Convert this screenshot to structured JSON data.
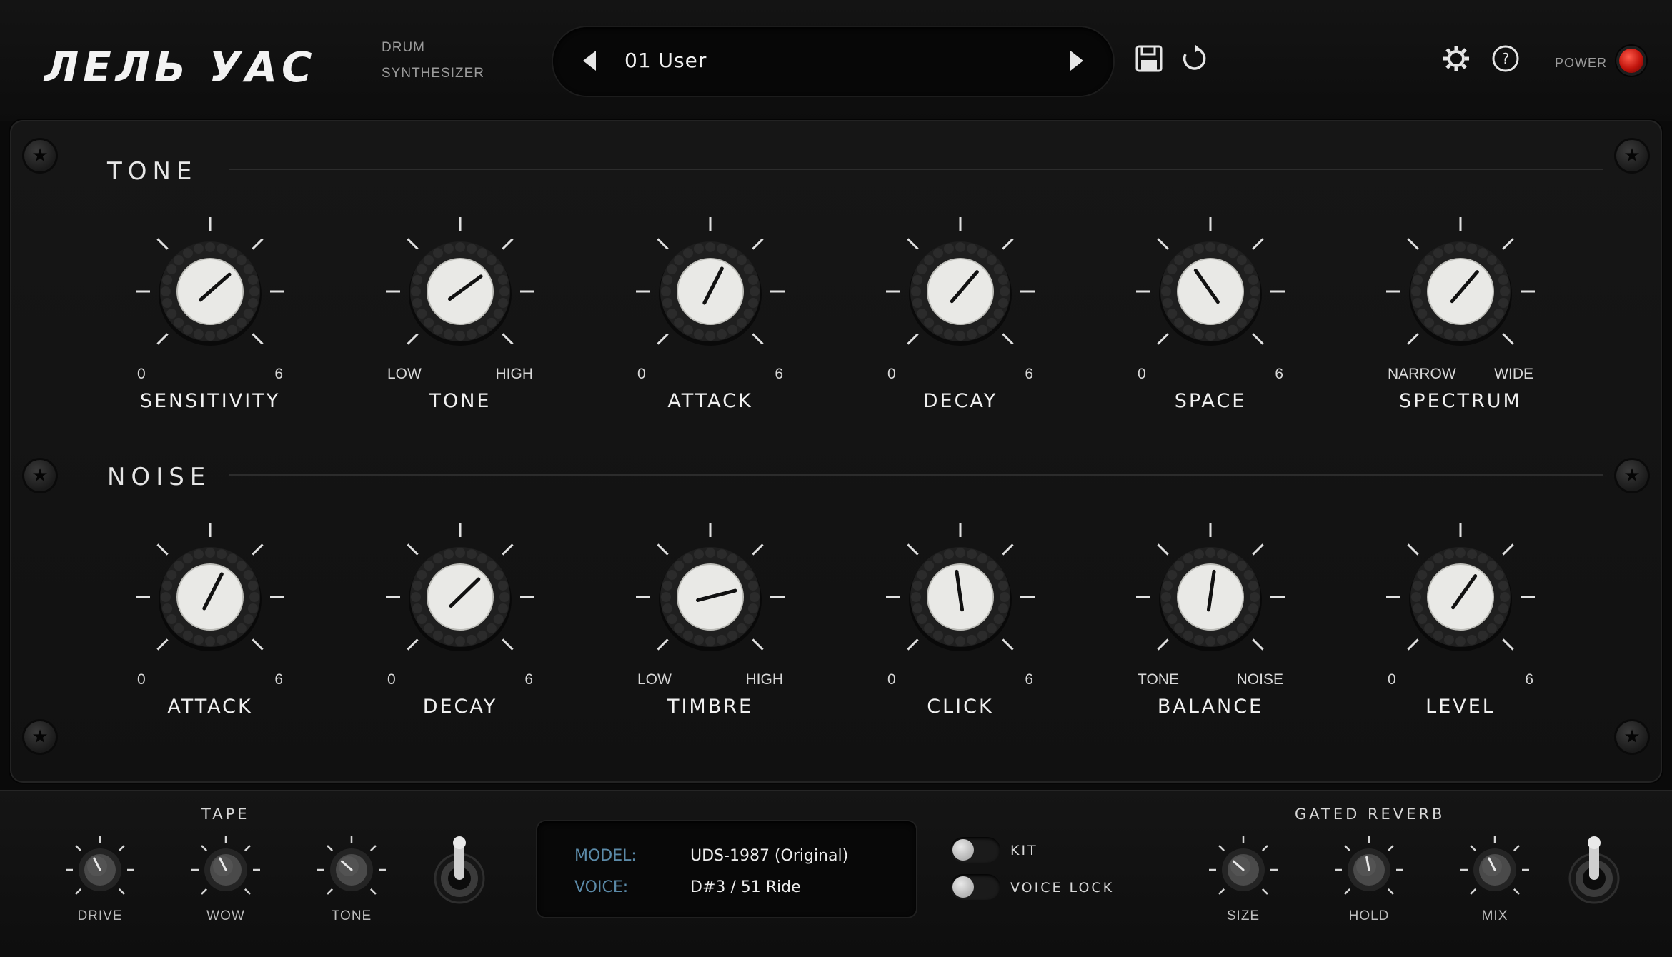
{
  "header": {
    "logo_text": "ЛЕЛЬ УАС",
    "logo_sub_1": "DRUM",
    "logo_sub_2": "SYNTHESIZER",
    "preset_name": "01 User",
    "power_label": "POWER"
  },
  "tone_section": {
    "title": "TONE",
    "knobs": [
      {
        "name": "SENSITIVITY",
        "min": "0",
        "max": "6",
        "value": 0.68
      },
      {
        "name": "TONE",
        "min": "LOW",
        "max": "HIGH",
        "value": 0.7
      },
      {
        "name": "ATTACK",
        "min": "0",
        "max": "6",
        "value": 0.6
      },
      {
        "name": "DECAY",
        "min": "0",
        "max": "6",
        "value": 0.65
      },
      {
        "name": "SPACE",
        "min": "0",
        "max": "6",
        "value": 0.37
      },
      {
        "name": "SPECTRUM",
        "min": "NARROW",
        "max": "WIDE",
        "value": 0.65
      }
    ]
  },
  "noise_section": {
    "title": "NOISE",
    "knobs": [
      {
        "name": "ATTACK",
        "min": "0",
        "max": "6",
        "value": 0.6
      },
      {
        "name": "DECAY",
        "min": "0",
        "max": "6",
        "value": 0.67
      },
      {
        "name": "TIMBRE",
        "min": "LOW",
        "max": "HIGH",
        "value": 0.78
      },
      {
        "name": "CLICK",
        "min": "0",
        "max": "6",
        "value": 0.47
      },
      {
        "name": "BALANCE",
        "min": "TONE",
        "max": "NOISE",
        "value": 0.53
      },
      {
        "name": "LEVEL",
        "min": "0",
        "max": "6",
        "value": 0.63
      }
    ]
  },
  "tape": {
    "title": "TAPE",
    "knobs": [
      {
        "name": "DRIVE",
        "value": 0.4
      },
      {
        "name": "WOW",
        "value": 0.4
      },
      {
        "name": "TONE",
        "value": 0.32
      }
    ]
  },
  "info": {
    "model_key": "MODEL:",
    "model_value": "UDS-1987 (Original)",
    "voice_key": "VOICE:",
    "voice_value": "D#3 / 51  Ride"
  },
  "switches": {
    "kit_label": "KIT",
    "voice_lock_label": "VOICE LOCK"
  },
  "gated_reverb": {
    "title": "GATED REVERB",
    "knobs": [
      {
        "name": "SIZE",
        "value": 0.32
      },
      {
        "name": "HOLD",
        "value": 0.46
      },
      {
        "name": "MIX",
        "value": 0.4
      }
    ]
  },
  "colors": {
    "power_led": "#d0190f",
    "info_key": "#5b8aa8",
    "knob_cap": "#e9e9e6"
  }
}
